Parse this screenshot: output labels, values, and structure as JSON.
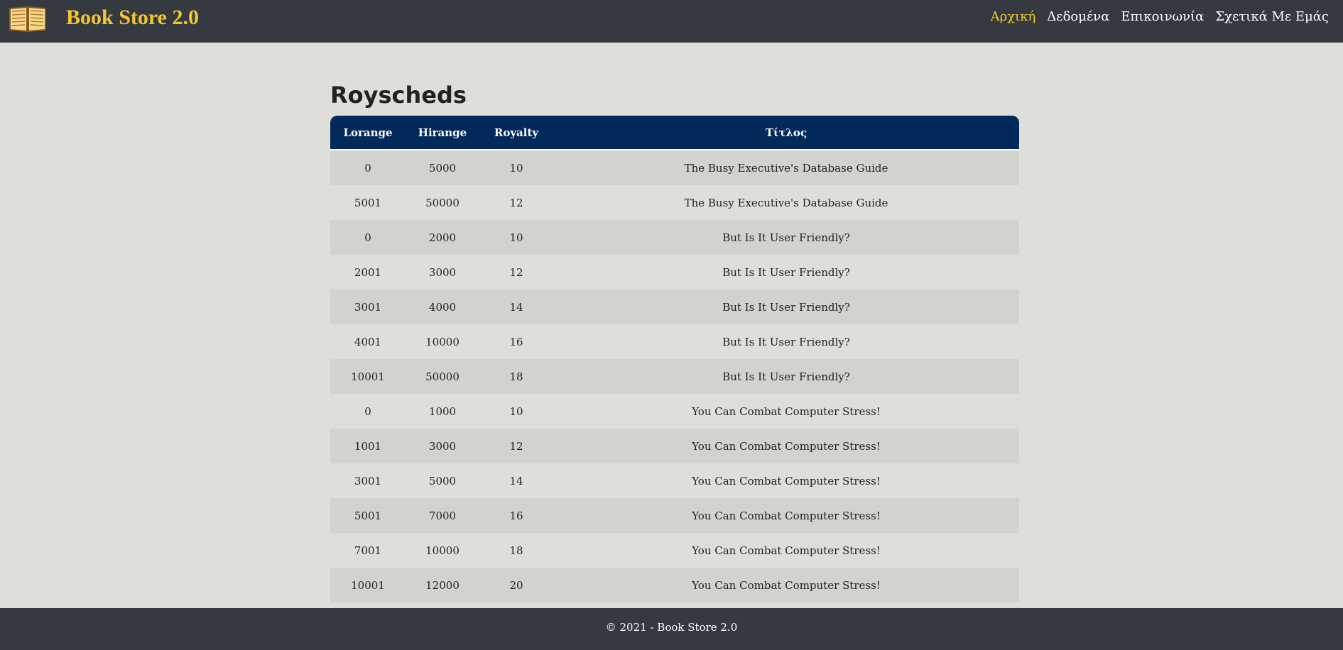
{
  "navbar": {
    "brand_title": "Book Store 2.0",
    "brand_icon": "open-book-icon",
    "links": [
      {
        "label": "Αρχική",
        "active": true
      },
      {
        "label": "Δεδομένα",
        "active": false
      },
      {
        "label": "Επικοινωνία",
        "active": false
      },
      {
        "label": "Σχετικά Με Εμάς",
        "active": false
      }
    ],
    "accent_color": "#f3c632",
    "background_color": "#343a40"
  },
  "main": {
    "title": "Royscheds",
    "table": {
      "header_color": "#012a5b",
      "columns": [
        "Lorange",
        "Hirange",
        "Royalty",
        "Τίτλος"
      ],
      "rows": [
        [
          "0",
          "5000",
          "10",
          "The Busy Executive's Database Guide"
        ],
        [
          "5001",
          "50000",
          "12",
          "The Busy Executive's Database Guide"
        ],
        [
          "0",
          "2000",
          "10",
          "But Is It User Friendly?"
        ],
        [
          "2001",
          "3000",
          "12",
          "But Is It User Friendly?"
        ],
        [
          "3001",
          "4000",
          "14",
          "But Is It User Friendly?"
        ],
        [
          "4001",
          "10000",
          "16",
          "But Is It User Friendly?"
        ],
        [
          "10001",
          "50000",
          "18",
          "But Is It User Friendly?"
        ],
        [
          "0",
          "1000",
          "10",
          "You Can Combat Computer Stress!"
        ],
        [
          "1001",
          "3000",
          "12",
          "You Can Combat Computer Stress!"
        ],
        [
          "3001",
          "5000",
          "14",
          "You Can Combat Computer Stress!"
        ],
        [
          "5001",
          "7000",
          "16",
          "You Can Combat Computer Stress!"
        ],
        [
          "7001",
          "10000",
          "18",
          "You Can Combat Computer Stress!"
        ],
        [
          "10001",
          "12000",
          "20",
          "You Can Combat Computer Stress!"
        ]
      ]
    }
  },
  "footer": {
    "text": "© 2021 - Book Store 2.0"
  }
}
